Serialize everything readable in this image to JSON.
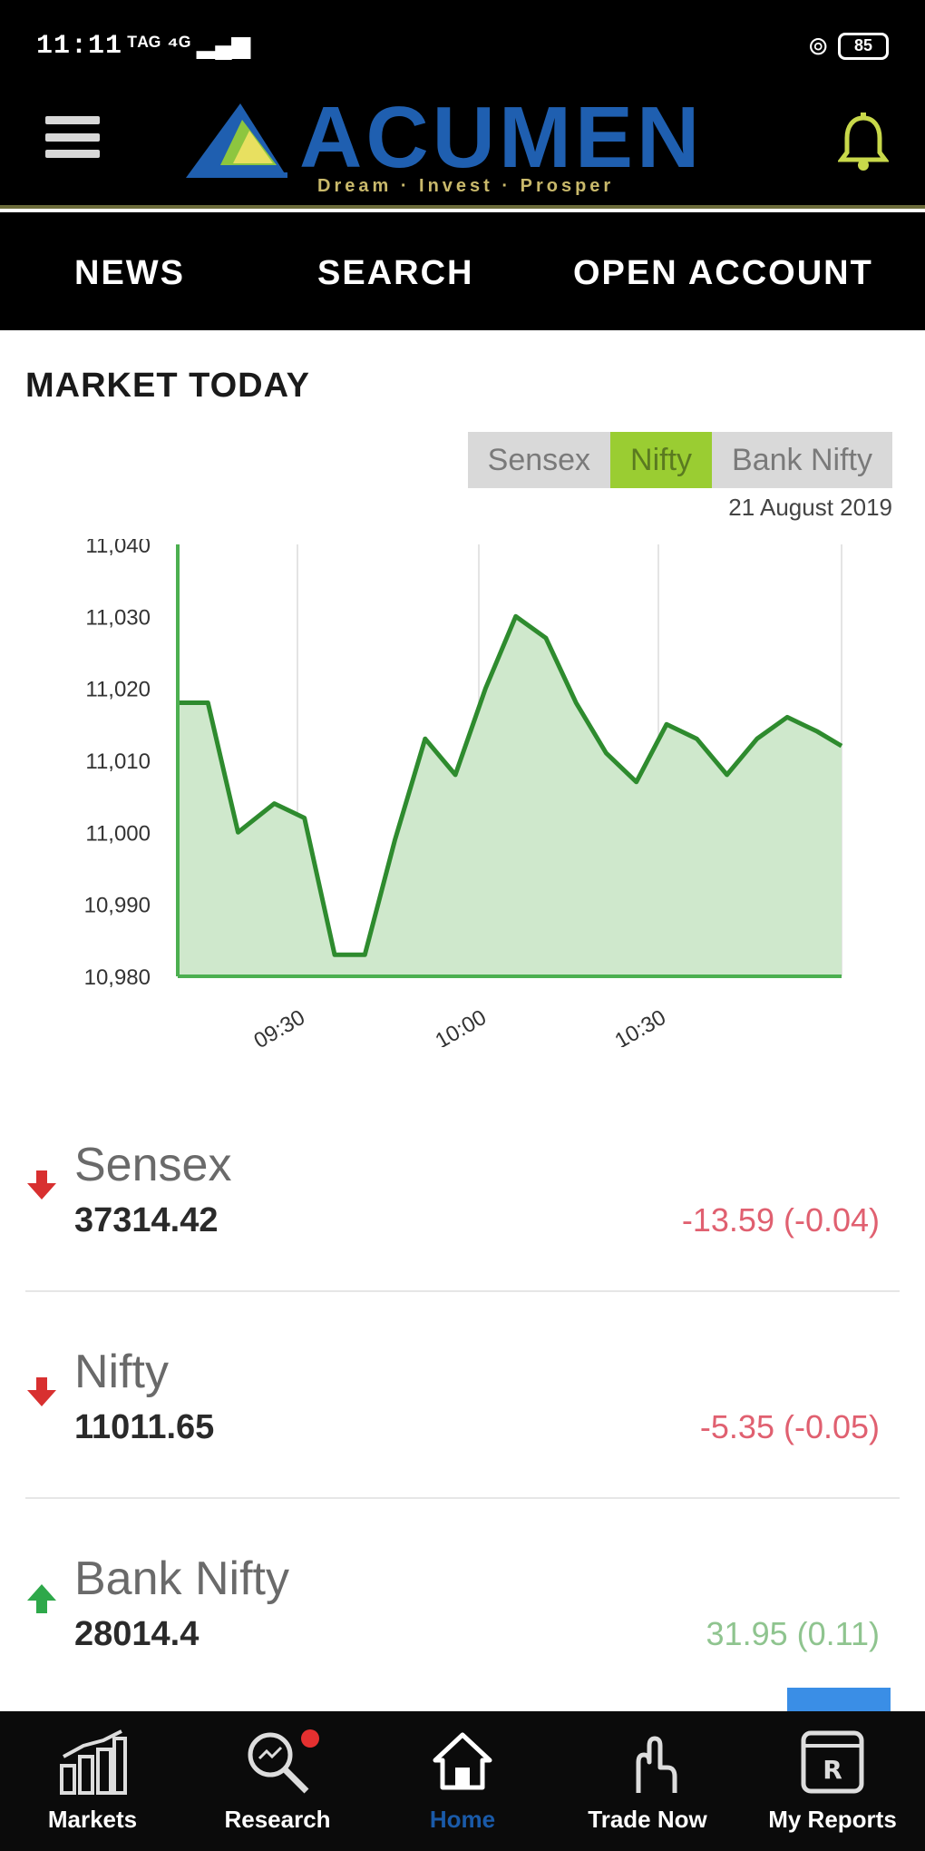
{
  "status_bar": {
    "time": "11:11",
    "signal_text": "ᵀᴬᴳ ⁴ᴳ ▂▄▆",
    "battery": "85"
  },
  "header": {
    "logo_text": "ACUMEN",
    "tagline": "Dream  ·  Invest  ·  Prosper"
  },
  "top_nav": [
    {
      "label": "NEWS"
    },
    {
      "label": "SEARCH"
    },
    {
      "label": "OPEN ACCOUNT"
    }
  ],
  "market": {
    "title": "MARKET TODAY",
    "tabs": [
      {
        "label": "Sensex",
        "active": false
      },
      {
        "label": "Nifty",
        "active": true
      },
      {
        "label": "Bank Nifty",
        "active": false
      }
    ],
    "date": "21 August 2019"
  },
  "chart_data": {
    "type": "area",
    "title": "",
    "xlabel": "",
    "ylabel": "",
    "x_ticks": [
      "09:30",
      "10:00",
      "10:30"
    ],
    "y_ticks": [
      "11,040",
      "11,030",
      "11,020",
      "11,010",
      "11,000",
      "10,990",
      "10,980"
    ],
    "ylim": [
      10980,
      11040
    ],
    "xlim": [
      0,
      110
    ],
    "grid": true,
    "series": [
      {
        "color": "#2e8b2e",
        "fill": "#cfe8cc",
        "x": [
          0,
          5,
          10,
          16,
          21,
          26,
          31,
          36,
          41,
          46,
          51,
          56,
          61,
          66,
          71,
          76,
          81,
          86,
          91,
          96,
          101,
          106,
          110
        ],
        "y": [
          11018,
          11018,
          11000,
          11004,
          11002,
          10983,
          10983,
          10999,
          11013,
          11008,
          11020,
          11030,
          11027,
          11018,
          11011,
          11007,
          11015,
          11013,
          11008,
          11013,
          11016,
          11014,
          11012
        ]
      }
    ]
  },
  "indices": [
    {
      "name": "Sensex",
      "value": "37314.42",
      "change": "-13.59 (-0.04)",
      "direction": "down",
      "color": "#e06070"
    },
    {
      "name": "Nifty",
      "value": "11011.65",
      "change": "-5.35 (-0.05)",
      "direction": "down",
      "color": "#e06070"
    },
    {
      "name": "Bank Nifty",
      "value": "28014.4",
      "change": "31.95 (0.11)",
      "direction": "up",
      "color": "#8fc48f"
    }
  ],
  "bottom_nav": [
    {
      "label": "Markets",
      "icon": "markets-icon",
      "active": false
    },
    {
      "label": "Research",
      "icon": "research-icon",
      "active": false
    },
    {
      "label": "Home",
      "icon": "home-icon",
      "active": true
    },
    {
      "label": "Trade Now",
      "icon": "trade-now-icon",
      "active": false
    },
    {
      "label": "My Reports",
      "icon": "my-reports-icon",
      "active": false
    }
  ]
}
